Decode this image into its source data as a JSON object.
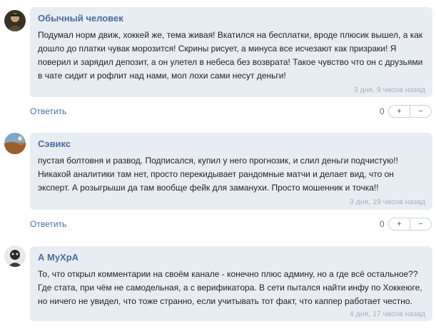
{
  "comments": [
    {
      "author": "Обычный человек",
      "text": "Подумал норм движ, хоккей же, тема живая! Вкатился на бесплатки, вроде плюсик вышел, а как дошло до платки чувак морозится! Скрины рисует, а минуса все исчезают как призраки! Я поверил и зарядил депозит, а он улетел в небеса без возврата! Такое чувство что он с друзьями в чате сидит и рофлит над нами, мол лохи сами несут деньги!",
      "time": "3 дня, 9 часов назад",
      "reply": "Ответить",
      "score": "0",
      "plus": "+",
      "minus": "−"
    },
    {
      "author": "Сэвикс",
      "text": "пустая болтовня и развод. Подписался, купил у него прогнозик, и слил деньги подчистую!! Никакой аналитики там нет, просто перекидывает рандомные матчи и делает вид, что он эксперт. А розыгрыши да там вообще фейк для заманухи. Просто мошенник и точка!!",
      "time": "3 дня, 19 часов назад",
      "reply": "Ответить",
      "score": "0",
      "plus": "+",
      "minus": "−"
    },
    {
      "author": "А МуХрА",
      "text": "То, что открыл комментарии на своём канале - конечно плюс админу, но а где всё остальное?? Где стата, при чём не самодельная, а с верификатора. В сети пытался найти инфу по Хоккеюге, но ничего не увидел, что тоже странно, если учитывать тот факт, что каппер работает честно.",
      "time": "4 дня, 17 часов назад"
    }
  ]
}
